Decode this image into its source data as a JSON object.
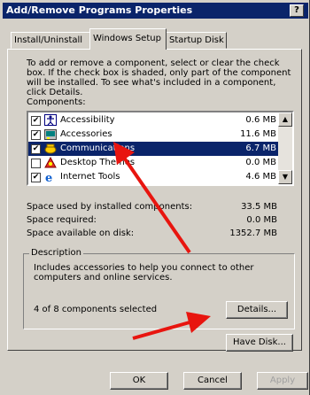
{
  "window": {
    "title": "Add/Remove Programs Properties",
    "help_label": "?"
  },
  "tabs": [
    {
      "label": "Install/Uninstall",
      "active": false
    },
    {
      "label": "Windows Setup",
      "active": true
    },
    {
      "label": "Startup Disk",
      "active": false
    }
  ],
  "intro": "To add or remove a component, select or clear the check box. If the check box is shaded, only part of the component will be installed. To see what's included in a component, click Details.",
  "components_label": "Components:",
  "components": [
    {
      "name": "Accessibility",
      "size": "0.6 MB",
      "checked": true,
      "icon": "accessibility-icon"
    },
    {
      "name": "Accessories",
      "size": "11.6 MB",
      "checked": true,
      "icon": "accessories-icon"
    },
    {
      "name": "Communications",
      "size": "6.7 MB",
      "checked": true,
      "selected": true,
      "icon": "communications-icon"
    },
    {
      "name": "Desktop Themes",
      "size": "0.0 MB",
      "checked": false,
      "icon": "desktop-themes-icon"
    },
    {
      "name": "Internet Tools",
      "size": "4.6 MB",
      "checked": true,
      "icon": "internet-tools-icon"
    }
  ],
  "space": {
    "used_label": "Space used by installed components:",
    "used_value": "33.5 MB",
    "required_label": "Space required:",
    "required_value": "0.0 MB",
    "available_label": "Space available on disk:",
    "available_value": "1352.7 MB"
  },
  "description": {
    "group_label": "Description",
    "text": "Includes accessories to help you connect to other computers and online services.",
    "count": "4 of 8 components selected"
  },
  "buttons": {
    "details": "Details...",
    "have_disk": "Have Disk...",
    "ok": "OK",
    "cancel": "Cancel",
    "apply": "Apply"
  },
  "colors": {
    "titlebar": "#0a246a",
    "selection": "#0a246a",
    "annotation_arrow": "#e8150f",
    "face": "#d4d0c8"
  }
}
